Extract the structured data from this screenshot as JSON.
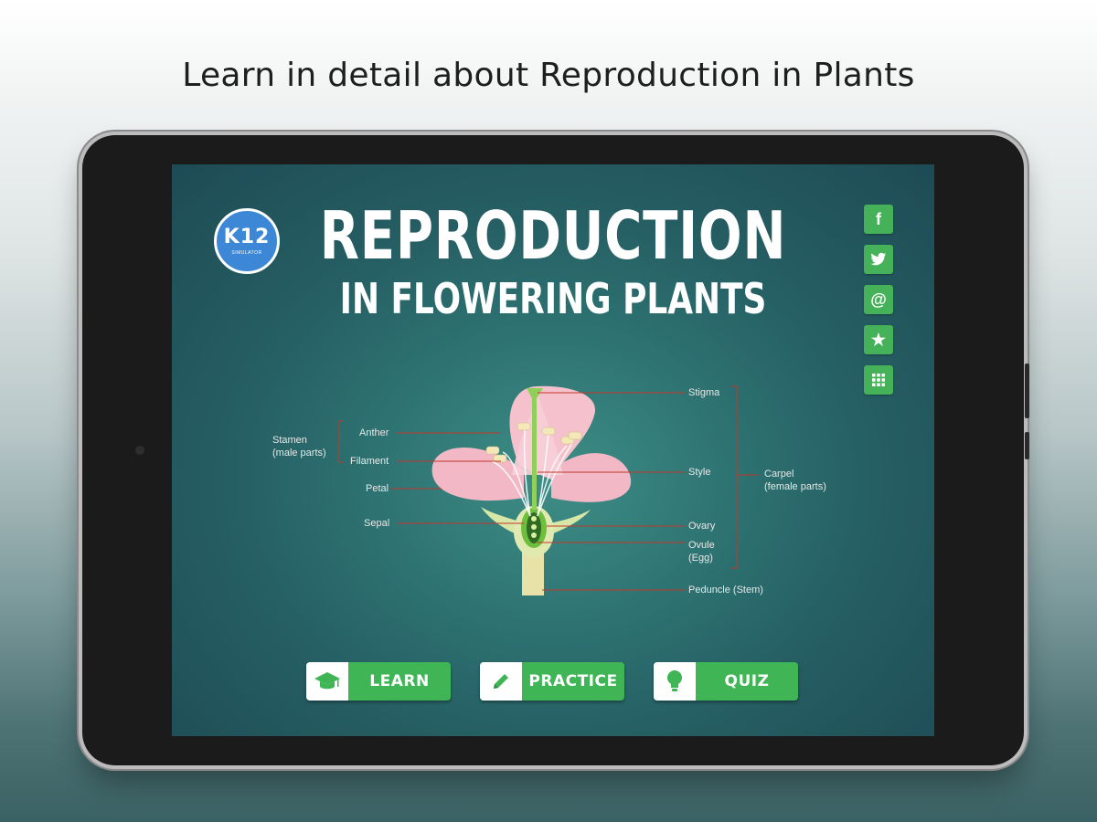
{
  "headline": "Learn in detail about Reproduction in Plants",
  "app": {
    "logo_main": "K12",
    "logo_sub": "SIMULATOR",
    "title_line1": "REPRODUCTION",
    "title_line2": "IN FLOWERING PLANTS"
  },
  "social": [
    {
      "icon": "facebook-icon",
      "glyph": "f"
    },
    {
      "icon": "twitter-icon",
      "glyph": "🐦"
    },
    {
      "icon": "email-icon",
      "glyph": "@"
    },
    {
      "icon": "star-icon",
      "glyph": "★"
    },
    {
      "icon": "grid-icon",
      "glyph": "▦"
    }
  ],
  "diagram": {
    "stamen": "Stamen",
    "stamen_sub": "(male parts)",
    "anther": "Anther",
    "filament": "Filament",
    "petal": "Petal",
    "sepal": "Sepal",
    "stigma": "Stigma",
    "style": "Style",
    "carpel": "Carpel",
    "carpel_sub": "(female parts)",
    "ovary": "Ovary",
    "ovule": "Ovule",
    "ovule_sub": "(Egg)",
    "peduncle": "Peduncle (Stem)"
  },
  "buttons": {
    "learn": "LEARN",
    "practice": "PRACTICE",
    "quiz": "QUIZ"
  },
  "colors": {
    "accent_green": "#3fb556",
    "logo_blue": "#3c87d6",
    "petal_pink": "#f2b8c6",
    "label_line_red": "#c0392b"
  }
}
